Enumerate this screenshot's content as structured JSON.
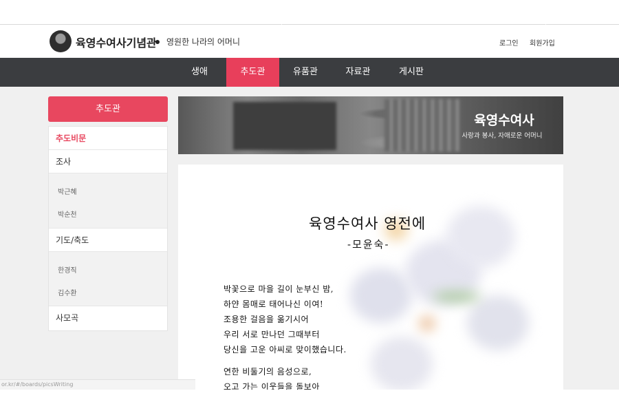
{
  "site": {
    "title": "육영수여사기념관",
    "subtitle": "영원한 나라의 어머니"
  },
  "util_nav": {
    "login": "로그인",
    "join": "회원가입"
  },
  "gnb": [
    {
      "label": "생애",
      "active": false
    },
    {
      "label": "추도관",
      "active": true
    },
    {
      "label": "유품관",
      "active": false
    },
    {
      "label": "자료관",
      "active": false
    },
    {
      "label": "게시판",
      "active": false
    }
  ],
  "lnb": {
    "title": "추도관",
    "items": [
      {
        "label": "추도비문",
        "active": true
      },
      {
        "label": "조사",
        "active": false,
        "sub": [
          "박근혜",
          "박순천"
        ]
      },
      {
        "label": "기도/축도",
        "active": false,
        "sub": [
          "한경직",
          "김수환"
        ]
      },
      {
        "label": "사모곡",
        "active": false
      }
    ]
  },
  "banner": {
    "title": "육영수여사",
    "subtitle": "사랑과 봉사, 자애로운 어머니"
  },
  "poem": {
    "title": "육영수여사 영전에",
    "author": "-모윤숙-",
    "lines": [
      "박꽃으로 마을 길이 눈부신 밤,",
      "하얀 몸매로 태어나신 이여!",
      "조용한 걸음을 옮기시어",
      "우리 서로 만나던 그때부터",
      "당신을 고운 아씨로 맞이했습니다.",
      "",
      "연한 비둘기의 음성으로,",
      "오고 가는 이웃들을 돌보아"
    ]
  },
  "status_bar": {
    "url": "or.kr/#/boards/picsWriting"
  },
  "colors": {
    "accent": "#e8475f",
    "nav_bg": "#3b3d40",
    "content_bg": "#f0f0f0"
  }
}
